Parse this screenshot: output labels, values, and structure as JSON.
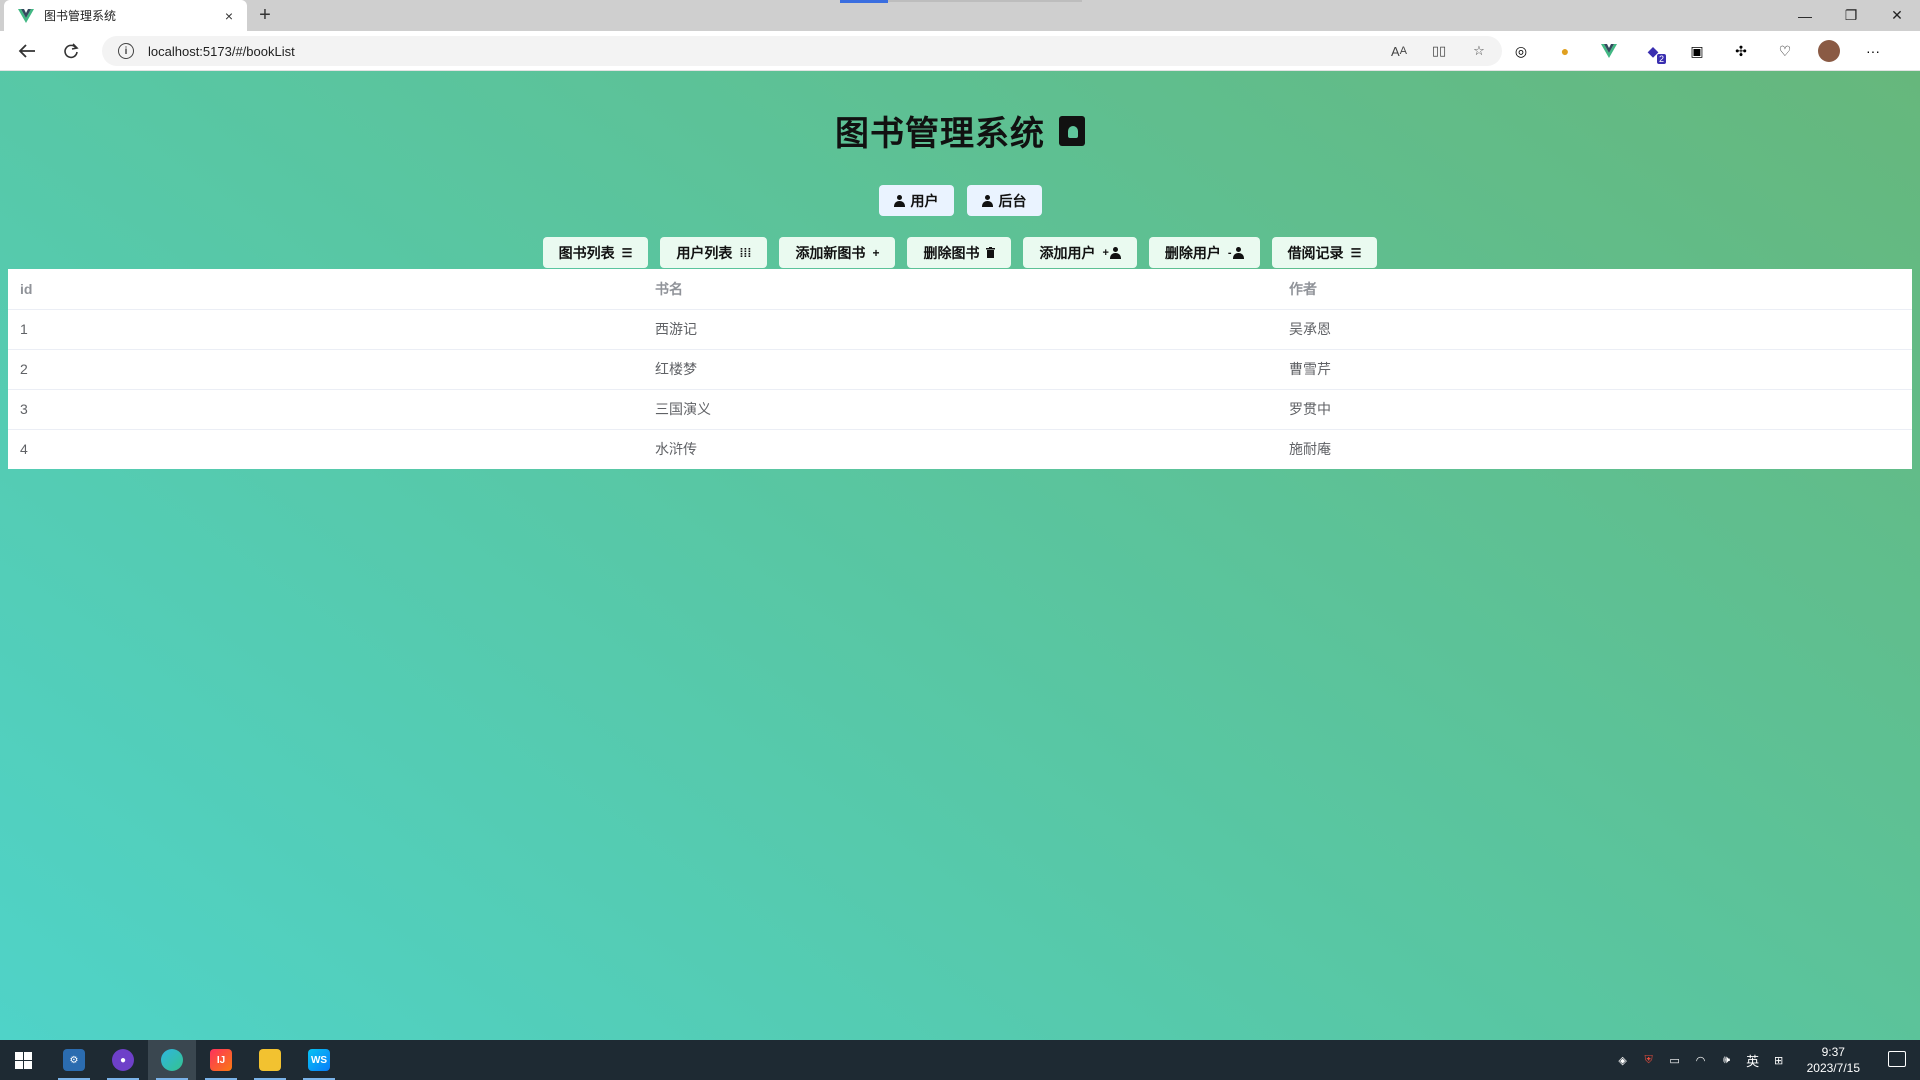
{
  "browser": {
    "tab_title": "图书管理系统",
    "url": "localhost:5173/#/bookList",
    "tab_close": "×",
    "new_tab": "+",
    "extensions": [
      "read-aloud-icon",
      "split-screen-icon",
      "favorite-star-icon",
      "copilot-icon",
      "palette-extension-icon",
      "vue-devtools-icon",
      "extension-badge-icon",
      "collections-icon",
      "extensions-puzzle-icon",
      "browser-essentials-icon",
      "profile-avatar",
      "more-menu-icon"
    ],
    "extension_badge": "2"
  },
  "app": {
    "title": "图书管理系统",
    "roles": [
      {
        "label": "用户"
      },
      {
        "label": "后台"
      }
    ],
    "nav": [
      {
        "label": "图书列表",
        "icon": "≡"
      },
      {
        "label": "用户列表",
        "icon": "⫶"
      },
      {
        "label": "添加新图书",
        "icon": "+"
      },
      {
        "label": "删除图书",
        "icon": "🗑"
      },
      {
        "label": "添加用户",
        "icon": "user-plus"
      },
      {
        "label": "删除用户",
        "icon": "user-minus"
      },
      {
        "label": "借阅记录",
        "icon": "≡"
      }
    ],
    "table": {
      "headers": [
        "id",
        "书名",
        "作者"
      ],
      "rows": [
        [
          "1",
          "西游记",
          "吴承恩"
        ],
        [
          "2",
          "红楼梦",
          "曹雪芹"
        ],
        [
          "3",
          "三国演义",
          "罗贯中"
        ],
        [
          "4",
          "水浒传",
          "施耐庵"
        ]
      ]
    }
  },
  "taskbar": {
    "apps": [
      "settings-app-icon",
      "github-desktop-icon",
      "edge-browser-icon",
      "intellij-idea-icon",
      "file-explorer-icon",
      "webstorm-icon"
    ],
    "webstorm_label": "WS",
    "ime": "英",
    "time": "9:37",
    "date": "2023/7/15"
  },
  "colors": {
    "bg_gradient_start": "#4fd3c8",
    "bg_gradient_end": "#66b77c",
    "role_button": "#eaf3ff",
    "nav_button": "#eafaf0",
    "taskbar": "#1e2a33"
  }
}
